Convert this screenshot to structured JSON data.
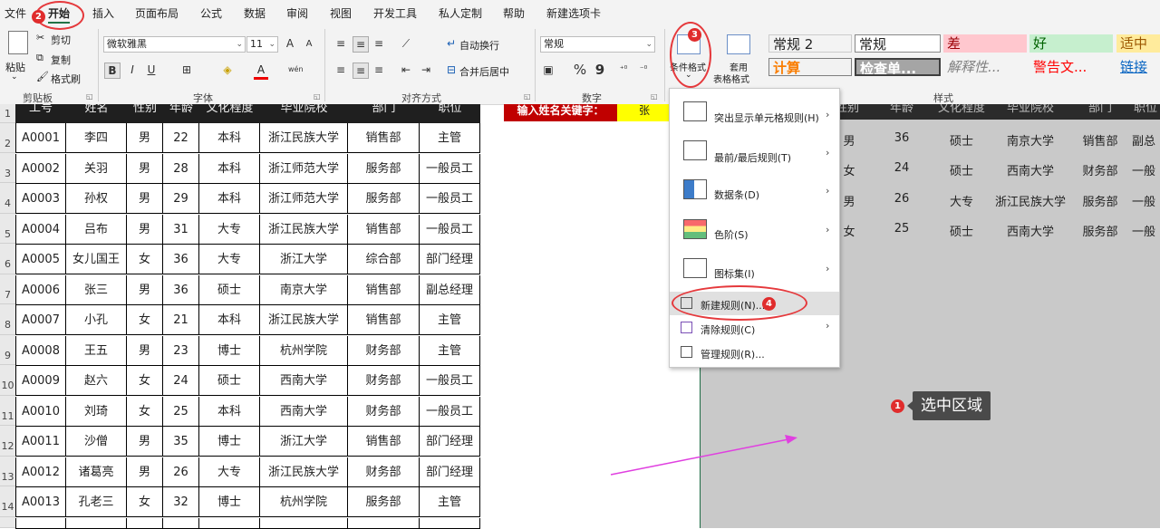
{
  "menu": {
    "tabs": [
      "文件",
      "开始",
      "插入",
      "页面布局",
      "公式",
      "数据",
      "审阅",
      "视图",
      "开发工具",
      "私人定制",
      "帮助",
      "新建选项卡"
    ]
  },
  "ribbon": {
    "clipboard": {
      "paste": "粘贴",
      "cut": "剪切",
      "copy": "复制",
      "format_painter": "格式刷",
      "group_label": "剪贴板"
    },
    "font": {
      "name": "微软雅黑",
      "size": "11",
      "bold": "B",
      "italic": "I",
      "underline": "U",
      "grow": "A",
      "shrink": "A",
      "color_a": "A",
      "wen": "wén",
      "group_label": "字体"
    },
    "alignment": {
      "wrap": "自动换行",
      "merge": "合并后居中",
      "group_label": "对齐方式"
    },
    "number": {
      "format": "常规",
      "percent": "%",
      "comma": "9",
      "group_label": "数字"
    },
    "styles": {
      "cond_format_label": "条件格式",
      "table_format_label": "套用",
      "table_format_label2": "表格格式",
      "cells": [
        {
          "text": "常规 2",
          "color": "#222222",
          "bg": "#ffffff"
        },
        {
          "text": "常规",
          "color": "#222222",
          "bg": "#ffffff"
        },
        {
          "text": "差",
          "color": "#9c0006",
          "bg": "#ffc7ce"
        },
        {
          "text": "好",
          "color": "#006100",
          "bg": "#c6efce"
        },
        {
          "text": "适中",
          "color": "#9c5700",
          "bg": "#ffeb9c"
        },
        {
          "text": "计算",
          "color": "#fa7d00",
          "bg": "#f2f2f2"
        },
        {
          "text": "检查单...",
          "color": "#ffffff",
          "bg": "#a5a5a5"
        },
        {
          "text": "解释性...",
          "color": "#7f7f7f",
          "bg": "#ffffff"
        },
        {
          "text": "警告文...",
          "color": "#ff0000",
          "bg": "#ffffff"
        },
        {
          "text": "链接",
          "color": "#0563c1",
          "bg": "#ffffff"
        }
      ],
      "group_label": "样式"
    }
  },
  "sheet": {
    "row_numbers": [
      "1",
      "2",
      "3",
      "4",
      "5",
      "6",
      "7",
      "8",
      "9",
      "10",
      "11",
      "12",
      "13",
      "14"
    ],
    "headers": [
      "工号",
      "姓名",
      "性别",
      "年龄",
      "文化程度",
      "毕业院校",
      "部门",
      "职位"
    ],
    "rows": [
      [
        "A0001",
        "李四",
        "男",
        "22",
        "本科",
        "浙江民族大学",
        "销售部",
        "主管"
      ],
      [
        "A0002",
        "关羽",
        "男",
        "28",
        "本科",
        "浙江师范大学",
        "服务部",
        "一般员工"
      ],
      [
        "A0003",
        "孙权",
        "男",
        "29",
        "本科",
        "浙江师范大学",
        "服务部",
        "一般员工"
      ],
      [
        "A0004",
        "吕布",
        "男",
        "31",
        "大专",
        "浙江民族大学",
        "销售部",
        "一般员工"
      ],
      [
        "A0005",
        "女儿国王",
        "女",
        "36",
        "大专",
        "浙江大学",
        "综合部",
        "部门经理"
      ],
      [
        "A0006",
        "张三",
        "男",
        "36",
        "硕士",
        "南京大学",
        "销售部",
        "副总经理"
      ],
      [
        "A0007",
        "小孔",
        "女",
        "21",
        "本科",
        "浙江民族大学",
        "销售部",
        "主管"
      ],
      [
        "A0008",
        "王五",
        "男",
        "23",
        "博士",
        "杭州学院",
        "财务部",
        "主管"
      ],
      [
        "A0009",
        "赵六",
        "女",
        "24",
        "硕士",
        "西南大学",
        "财务部",
        "一般员工"
      ],
      [
        "A0010",
        "刘琦",
        "女",
        "25",
        "本科",
        "西南大学",
        "财务部",
        "一般员工"
      ],
      [
        "A0011",
        "沙僧",
        "男",
        "35",
        "博士",
        "浙江大学",
        "销售部",
        "部门经理"
      ],
      [
        "A0012",
        "诸葛亮",
        "男",
        "26",
        "大专",
        "浙江民族大学",
        "财务部",
        "部门经理"
      ],
      [
        "A0013",
        "孔老三",
        "女",
        "32",
        "博士",
        "杭州学院",
        "服务部",
        "主管"
      ]
    ],
    "keyword_label": "输入姓名关键字：",
    "keyword_value": "张",
    "result_headers": [
      "性别",
      "年龄",
      "文化程度",
      "毕业院校",
      "部门",
      "职位"
    ],
    "result_rows": [
      [
        "男",
        "36",
        "硕士",
        "南京大学",
        "销售部",
        "副总"
      ],
      [
        "女",
        "24",
        "硕士",
        "西南大学",
        "财务部",
        "一般"
      ],
      [
        "男",
        "26",
        "大专",
        "浙江民族大学",
        "服务部",
        "一般"
      ],
      [
        "女",
        "25",
        "硕士",
        "西南大学",
        "服务部",
        "一般"
      ]
    ]
  },
  "dropdown": {
    "items": [
      {
        "label": "突出显示单元格规则(H)"
      },
      {
        "label": "最前/最后规则(T)"
      },
      {
        "label": "数据条(D)"
      },
      {
        "label": "色阶(S)"
      },
      {
        "label": "图标集(I)"
      },
      {
        "label": "新建规则(N)..."
      },
      {
        "label": "清除规则(C)"
      },
      {
        "label": "管理规则(R)..."
      }
    ]
  },
  "annotations": {
    "badge1": "1",
    "badge2": "2",
    "badge3": "3",
    "badge4": "4",
    "tooltip": "选中区域",
    "colors": {
      "circle": "#e5393c",
      "arrow": "#e040e0"
    }
  }
}
